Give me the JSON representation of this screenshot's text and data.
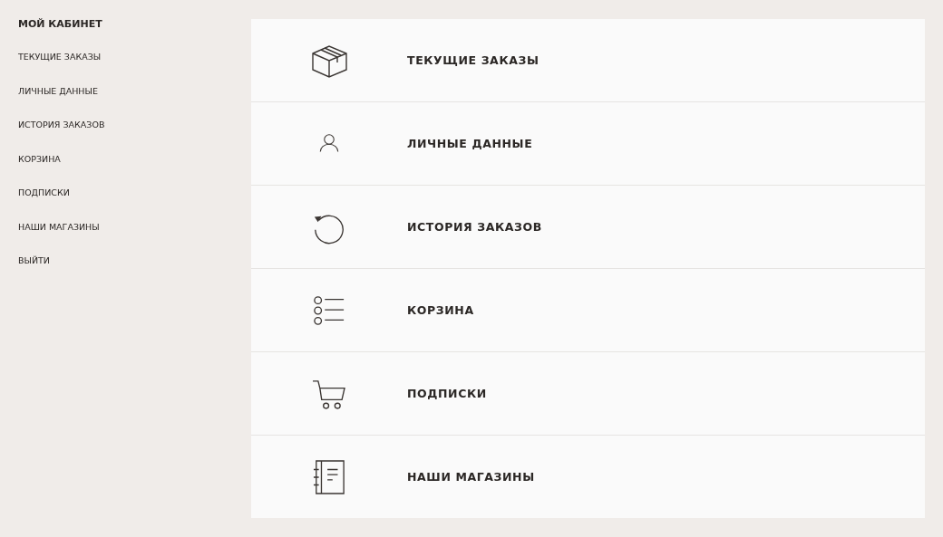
{
  "sidebar": {
    "title": "МОЙ КАБИНЕТ",
    "items": [
      {
        "label": "ТЕКУЩИЕ ЗАКАЗЫ"
      },
      {
        "label": "ЛИЧНЫЕ ДАННЫЕ"
      },
      {
        "label": "ИСТОРИЯ ЗАКАЗОВ"
      },
      {
        "label": "КОРЗИНА"
      },
      {
        "label": "ПОДПИСКИ"
      },
      {
        "label": "НАШИ МАГАЗИНЫ"
      },
      {
        "label": "ВЫЙТИ"
      }
    ]
  },
  "sections": [
    {
      "kind": "box",
      "label": "ТЕКУЩИЕ ЗАКАЗЫ"
    },
    {
      "kind": "person",
      "label": "ЛИЧНЫЕ ДАННЫЕ"
    },
    {
      "kind": "history",
      "label": "ИСТОРИЯ ЗАКАЗОВ"
    },
    {
      "kind": "list",
      "label": "КОРЗИНА"
    },
    {
      "kind": "cart",
      "label": "ПОДПИСКИ"
    },
    {
      "kind": "notebook",
      "label": "НАШИ МАГАЗИНЫ"
    }
  ]
}
